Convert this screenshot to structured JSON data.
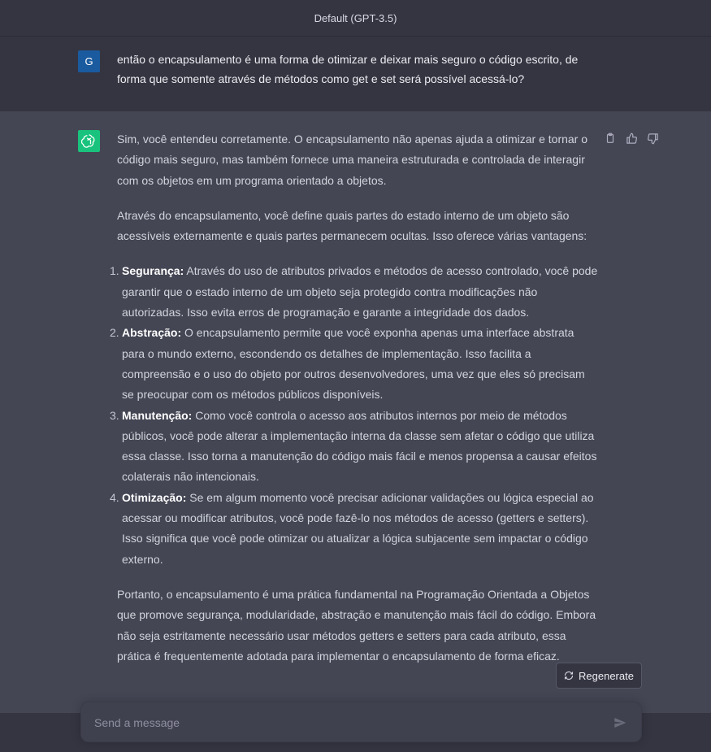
{
  "header": {
    "title": "Default (GPT-3.5)"
  },
  "user_message": {
    "avatar_letter": "G",
    "avatar_color": "#1a5a9e",
    "text": "então o encapsulamento é uma forma de otimizar e deixar mais seguro o código escrito, de forma que somente através de métodos como get e set será possível acessá-lo?"
  },
  "assistant_message": {
    "avatar_color": "#19c37d",
    "intro": "Sim, você entendeu corretamente. O encapsulamento não apenas ajuda a otimizar e tornar o código mais seguro, mas também fornece uma maneira estruturada e controlada de interagir com os objetos em um programa orientado a objetos.",
    "paragraph2": "Através do encapsulamento, você define quais partes do estado interno de um objeto são acessíveis externamente e quais partes permanecem ocultas. Isso oferece várias vantagens:",
    "list": [
      {
        "num": "1.",
        "title": "Segurança:",
        "text": " Através do uso de atributos privados e métodos de acesso controlado, você pode garantir que o estado interno de um objeto seja protegido contra modificações não autorizadas. Isso evita erros de programação e garante a integridade dos dados."
      },
      {
        "num": "2.",
        "title": "Abstração:",
        "text": " O encapsulamento permite que você exponha apenas uma interface abstrata para o mundo externo, escondendo os detalhes de implementação. Isso facilita a compreensão e o uso do objeto por outros desenvolvedores, uma vez que eles só precisam se preocupar com os métodos públicos disponíveis."
      },
      {
        "num": "3.",
        "title": "Manutenção:",
        "text": " Como você controla o acesso aos atributos internos por meio de métodos públicos, você pode alterar a implementação interna da classe sem afetar o código que utiliza essa classe. Isso torna a manutenção do código mais fácil e menos propensa a causar efeitos colaterais não intencionais."
      },
      {
        "num": "4.",
        "title": "Otimização:",
        "text": " Se em algum momento você precisar adicionar validações ou lógica especial ao acessar ou modificar atributos, você pode fazê-lo nos métodos de acesso (getters e setters). Isso significa que você pode otimizar ou atualizar a lógica subjacente sem impactar o código externo."
      }
    ],
    "conclusion": "Portanto, o encapsulamento é uma prática fundamental na Programação Orientada a Objetos que promove segurança, modularidade, abstração e manutenção mais fácil do código. Embora não seja estritamente necessário usar métodos getters e setters para cada atributo, essa prática é frequentemente adotada para implementar o encapsulamento de forma eficaz.",
    "actions": {
      "copy_icon": "clipboard-icon",
      "like_icon": "thumbs-up-icon",
      "dislike_icon": "thumbs-down-icon"
    }
  },
  "regenerate": {
    "label": "Regenerate",
    "icon": "refresh-icon"
  },
  "composer": {
    "placeholder": "Send a message",
    "value": "",
    "send_icon": "send-icon"
  }
}
